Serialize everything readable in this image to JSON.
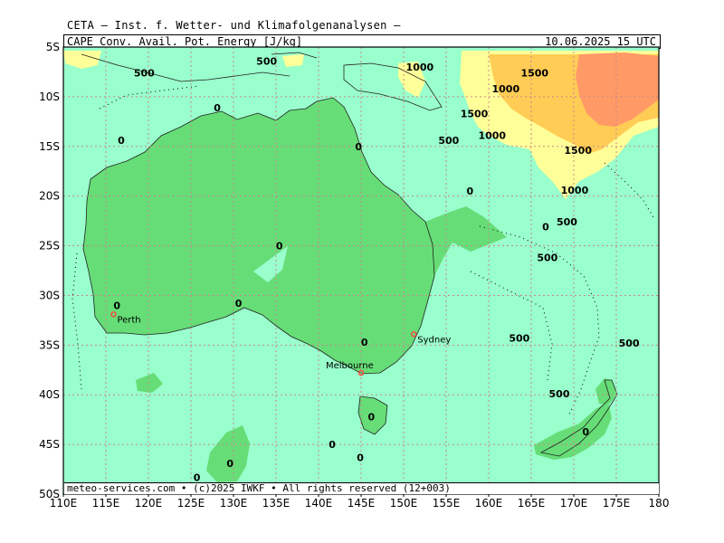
{
  "header": {
    "institute": "CETA — Inst. f. Wetter- und Klimafolgenanalysen —",
    "parameter": "CAPE_Conv._Avail._Pot._Energy_[J/kg]",
    "valid_time": "10.06.2025 15 UTC"
  },
  "footer": {
    "credit": "meteo-services.com • (c)2025 IWKF • All rights reserved (12+003)"
  },
  "axes": {
    "lon_labels": [
      "110E",
      "115E",
      "120E",
      "125E",
      "130E",
      "135E",
      "140E",
      "145E",
      "150E",
      "155E",
      "160E",
      "165E",
      "170E",
      "175E",
      "180"
    ],
    "lat_labels": [
      "5S",
      "10S",
      "15S",
      "20S",
      "25S",
      "30S",
      "35S",
      "40S",
      "45S",
      "50S"
    ],
    "lon_range": [
      110,
      180
    ],
    "lat_range": [
      -5,
      -50
    ],
    "grid": true
  },
  "colors": {
    "sea": "#99ffcc",
    "land_low": "#66dd77",
    "cape_500": "#ffff99",
    "cape_1000": "#ffcc55",
    "cape_1500": "#ff9966",
    "grid": "#c88a8a",
    "city_marker": "#ff4444"
  },
  "cities": [
    {
      "name": "Perth",
      "lon": 115.9,
      "lat": -31.9
    },
    {
      "name": "Sydney",
      "lon": 151.2,
      "lat": -33.9
    },
    {
      "name": "Melbourne",
      "lon": 145.0,
      "lat": -37.8
    }
  ],
  "contour_labels": [
    {
      "text": "500",
      "lon": 119.5,
      "lat": -7.6
    },
    {
      "text": "500",
      "lon": 133.9,
      "lat": -6.4
    },
    {
      "text": "1000",
      "lon": 151.9,
      "lat": -7.0
    },
    {
      "text": "1500",
      "lon": 165.4,
      "lat": -7.6
    },
    {
      "text": "1000",
      "lon": 162.0,
      "lat": -9.2
    },
    {
      "text": "1500",
      "lon": 158.3,
      "lat": -11.7
    },
    {
      "text": "1000",
      "lon": 160.4,
      "lat": -13.9
    },
    {
      "text": "500",
      "lon": 155.3,
      "lat": -14.4
    },
    {
      "text": "1500",
      "lon": 170.5,
      "lat": -15.4
    },
    {
      "text": "1000",
      "lon": 170.1,
      "lat": -19.4
    },
    {
      "text": "500",
      "lon": 169.2,
      "lat": -22.6
    },
    {
      "text": "500",
      "lon": 166.9,
      "lat": -26.2
    },
    {
      "text": "500",
      "lon": 163.6,
      "lat": -34.3
    },
    {
      "text": "500",
      "lon": 176.5,
      "lat": -34.8
    },
    {
      "text": "500",
      "lon": 168.3,
      "lat": -39.9
    },
    {
      "text": "0",
      "lon": 128.1,
      "lat": -11.1
    },
    {
      "text": "0",
      "lon": 116.8,
      "lat": -14.4
    },
    {
      "text": "0",
      "lon": 144.7,
      "lat": -15.0
    },
    {
      "text": "0",
      "lon": 157.8,
      "lat": -19.5
    },
    {
      "text": "0",
      "lon": 166.7,
      "lat": -23.1
    },
    {
      "text": "0",
      "lon": 135.4,
      "lat": -25.0
    },
    {
      "text": "0",
      "lon": 116.3,
      "lat": -31.0
    },
    {
      "text": "0",
      "lon": 130.6,
      "lat": -30.8
    },
    {
      "text": "0",
      "lon": 145.4,
      "lat": -34.7
    },
    {
      "text": "0",
      "lon": 146.2,
      "lat": -42.2
    },
    {
      "text": "0",
      "lon": 171.4,
      "lat": -43.7
    },
    {
      "text": "0",
      "lon": 141.6,
      "lat": -45.0
    },
    {
      "text": "0",
      "lon": 144.9,
      "lat": -46.3
    },
    {
      "text": "0",
      "lon": 129.6,
      "lat": -46.9
    },
    {
      "text": "0",
      "lon": 125.7,
      "lat": -48.3
    }
  ]
}
